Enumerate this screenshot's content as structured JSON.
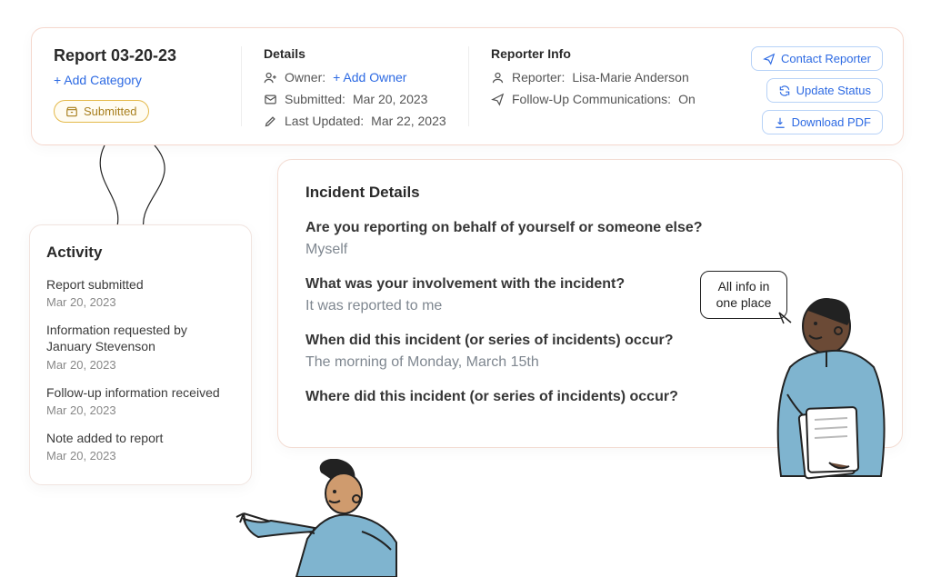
{
  "report": {
    "title": "Report 03-20-23",
    "add_category_label": "+ Add Category",
    "status_label": "Submitted"
  },
  "details": {
    "section_label": "Details",
    "owner_label": "Owner:",
    "owner_action": "+ Add Owner",
    "submitted_label": "Submitted:",
    "submitted_value": "Mar 20, 2023",
    "updated_label": "Last Updated:",
    "updated_value": "Mar 22, 2023"
  },
  "reporter": {
    "section_label": "Reporter Info",
    "reporter_label": "Reporter:",
    "reporter_name": "Lisa-Marie Anderson",
    "followup_label": "Follow-Up Communications:",
    "followup_value": "On"
  },
  "actions": {
    "contact": "Contact Reporter",
    "update": "Update Status",
    "download": "Download PDF"
  },
  "activity": {
    "title": "Activity",
    "items": [
      {
        "text": "Report submitted",
        "date": "Mar 20, 2023"
      },
      {
        "text": "Information requested by January Stevenson",
        "date": "Mar 20, 2023"
      },
      {
        "text": "Follow-up information received",
        "date": "Mar 20, 2023"
      },
      {
        "text": "Note added to report",
        "date": "Mar 20, 2023"
      }
    ]
  },
  "incident": {
    "title": "Incident Details",
    "qa": [
      {
        "q": "Are you reporting on behalf of yourself or someone else?",
        "a": "Myself"
      },
      {
        "q": "What was your involvement with the incident?",
        "a": "It was reported to me"
      },
      {
        "q": "When did this incident (or series of incidents) occur?",
        "a": "The morning of Monday, March 15th"
      },
      {
        "q": "Where did this incident (or series of incidents) occur?",
        "a": ""
      }
    ]
  },
  "speech_bubble": "All info in one place"
}
